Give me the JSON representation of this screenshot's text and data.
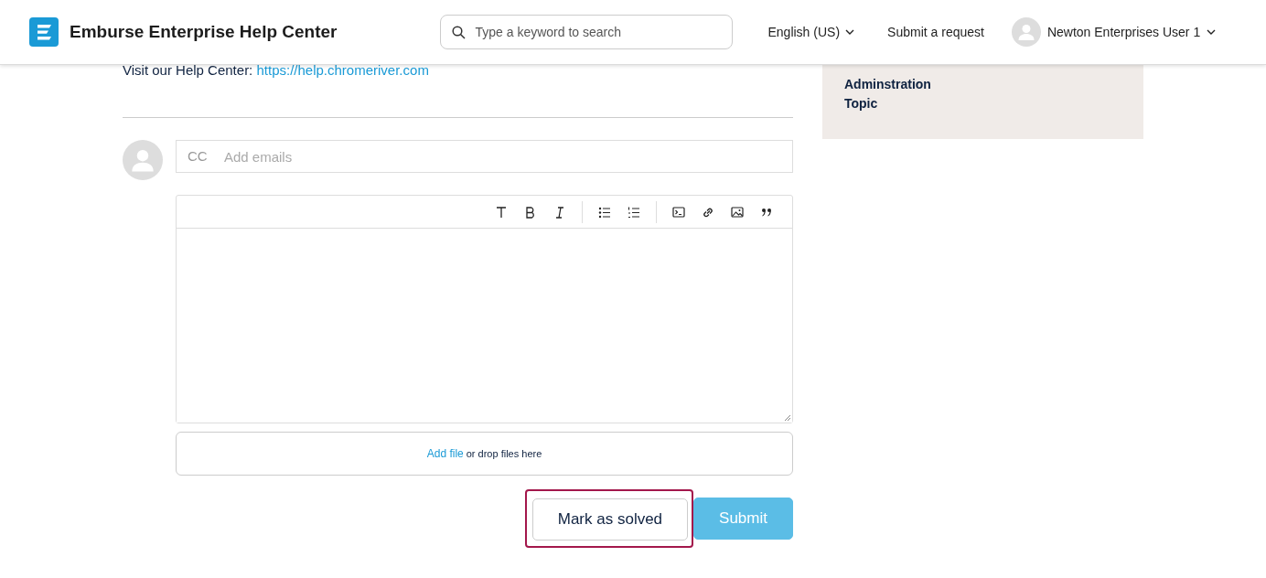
{
  "header": {
    "title": "Emburse Enterprise Help Center",
    "search": {
      "placeholder": "Type a keyword to search"
    },
    "language": "English (US)",
    "submit_link": "Submit a request",
    "user": "Newton Enterprises User 1"
  },
  "content": {
    "help_text": "Visit our Help Center:",
    "help_link": "https://help.chromeriver.com"
  },
  "cc": {
    "label": "CC",
    "placeholder": "Add emails"
  },
  "toolbar": [
    [
      {
        "kind": "text"
      },
      {
        "kind": "bold"
      },
      {
        "kind": "italic"
      }
    ],
    [
      {
        "kind": "bullets"
      },
      {
        "kind": "numbers"
      }
    ],
    [
      {
        "kind": "code"
      },
      {
        "kind": "link"
      },
      {
        "kind": "image"
      },
      {
        "kind": "quote"
      }
    ]
  ],
  "attachments": {
    "link": "Add file",
    "text": "or drop files here"
  },
  "buttons": [
    {
      "label": "Mark as solved",
      "kind": "secondary",
      "highlighted": true
    },
    {
      "label": "Submit",
      "kind": "primary",
      "highlighted": false
    }
  ],
  "sidebar": {
    "items": [
      "Adminstration",
      "Topic"
    ]
  }
}
